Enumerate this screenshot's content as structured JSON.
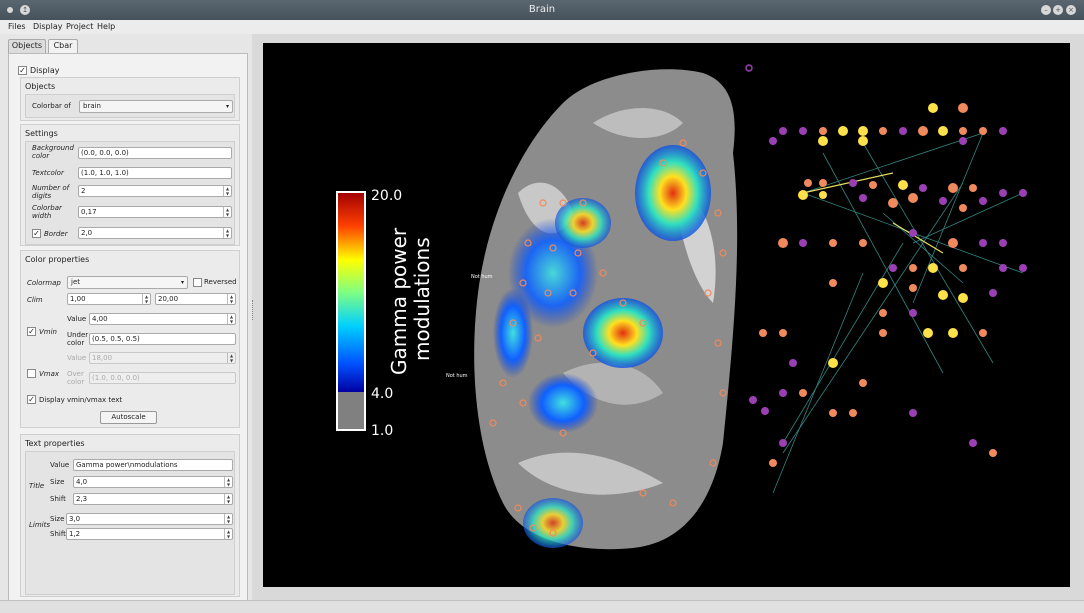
{
  "window": {
    "title": "Brain"
  },
  "menu": [
    "Files",
    "Display",
    "Project",
    "Help"
  ],
  "tabs": [
    "Objects",
    "Cbar"
  ],
  "display_label": "Display",
  "objects_section": {
    "title": "Objects",
    "colorbar_of_label": "Colorbar of",
    "colorbar_of_value": "brain"
  },
  "settings_section": {
    "title": "Settings",
    "background_color_label": "Background color",
    "background_color_value": "(0.0, 0.0, 0.0)",
    "textcolor_label": "Textcolor",
    "textcolor_value": "(1.0, 1.0, 1.0)",
    "digits_label": "Number of digits",
    "digits_value": "2",
    "width_label": "Colorbar width",
    "width_value": "0,17",
    "border_label": "Border",
    "border_value": "2,0"
  },
  "color_section": {
    "title": "Color properties",
    "colormap_label": "Colormap",
    "colormap_value": "jet",
    "reversed_label": "Reversed",
    "clim_label": "Clim",
    "clim_min": "1,00",
    "clim_max": "20,00",
    "vmin_label": "Vmin",
    "vmin_value_label": "Value",
    "vmin_value": "4,00",
    "under_color_label": "Under color",
    "under_color_value": "(0.5, 0.5, 0.5)",
    "vmax_label": "Vmax",
    "vmax_value_label": "Value",
    "vmax_value": "18,00",
    "over_color_label": "Over color",
    "over_color_value": "(1.0, 0.0, 0.0)",
    "display_vminmax_label": "Display vmin/vmax text",
    "autoscale_label": "Autoscale"
  },
  "text_section": {
    "title": "Text properties",
    "title_group_label": "Title",
    "value_label": "Value",
    "title_value": "Gamma power\\nmodulations",
    "size_label": "Size",
    "title_size": "4,0",
    "shift_label": "Shift",
    "title_shift": "2,3",
    "limits_group_label": "Limits",
    "limits_size": "3,0",
    "limits_shift": "1,2"
  },
  "colorbar": {
    "title_line1": "Gamma power",
    "title_line2": "modulations",
    "max_label": "20.0",
    "vmin_label": "4.0",
    "min_label": "1.0"
  },
  "scene_labels": [
    "Not hum",
    "Not hum"
  ],
  "colors": {
    "canvas_bg": "#000000",
    "brain_gray": "#8c8c8c",
    "under_color": "#808080",
    "node_purple": "#9b3fb5",
    "node_orange": "#f08a5d",
    "node_yellow": "#ffe14a",
    "edge_teal": "#3fa7a0"
  }
}
